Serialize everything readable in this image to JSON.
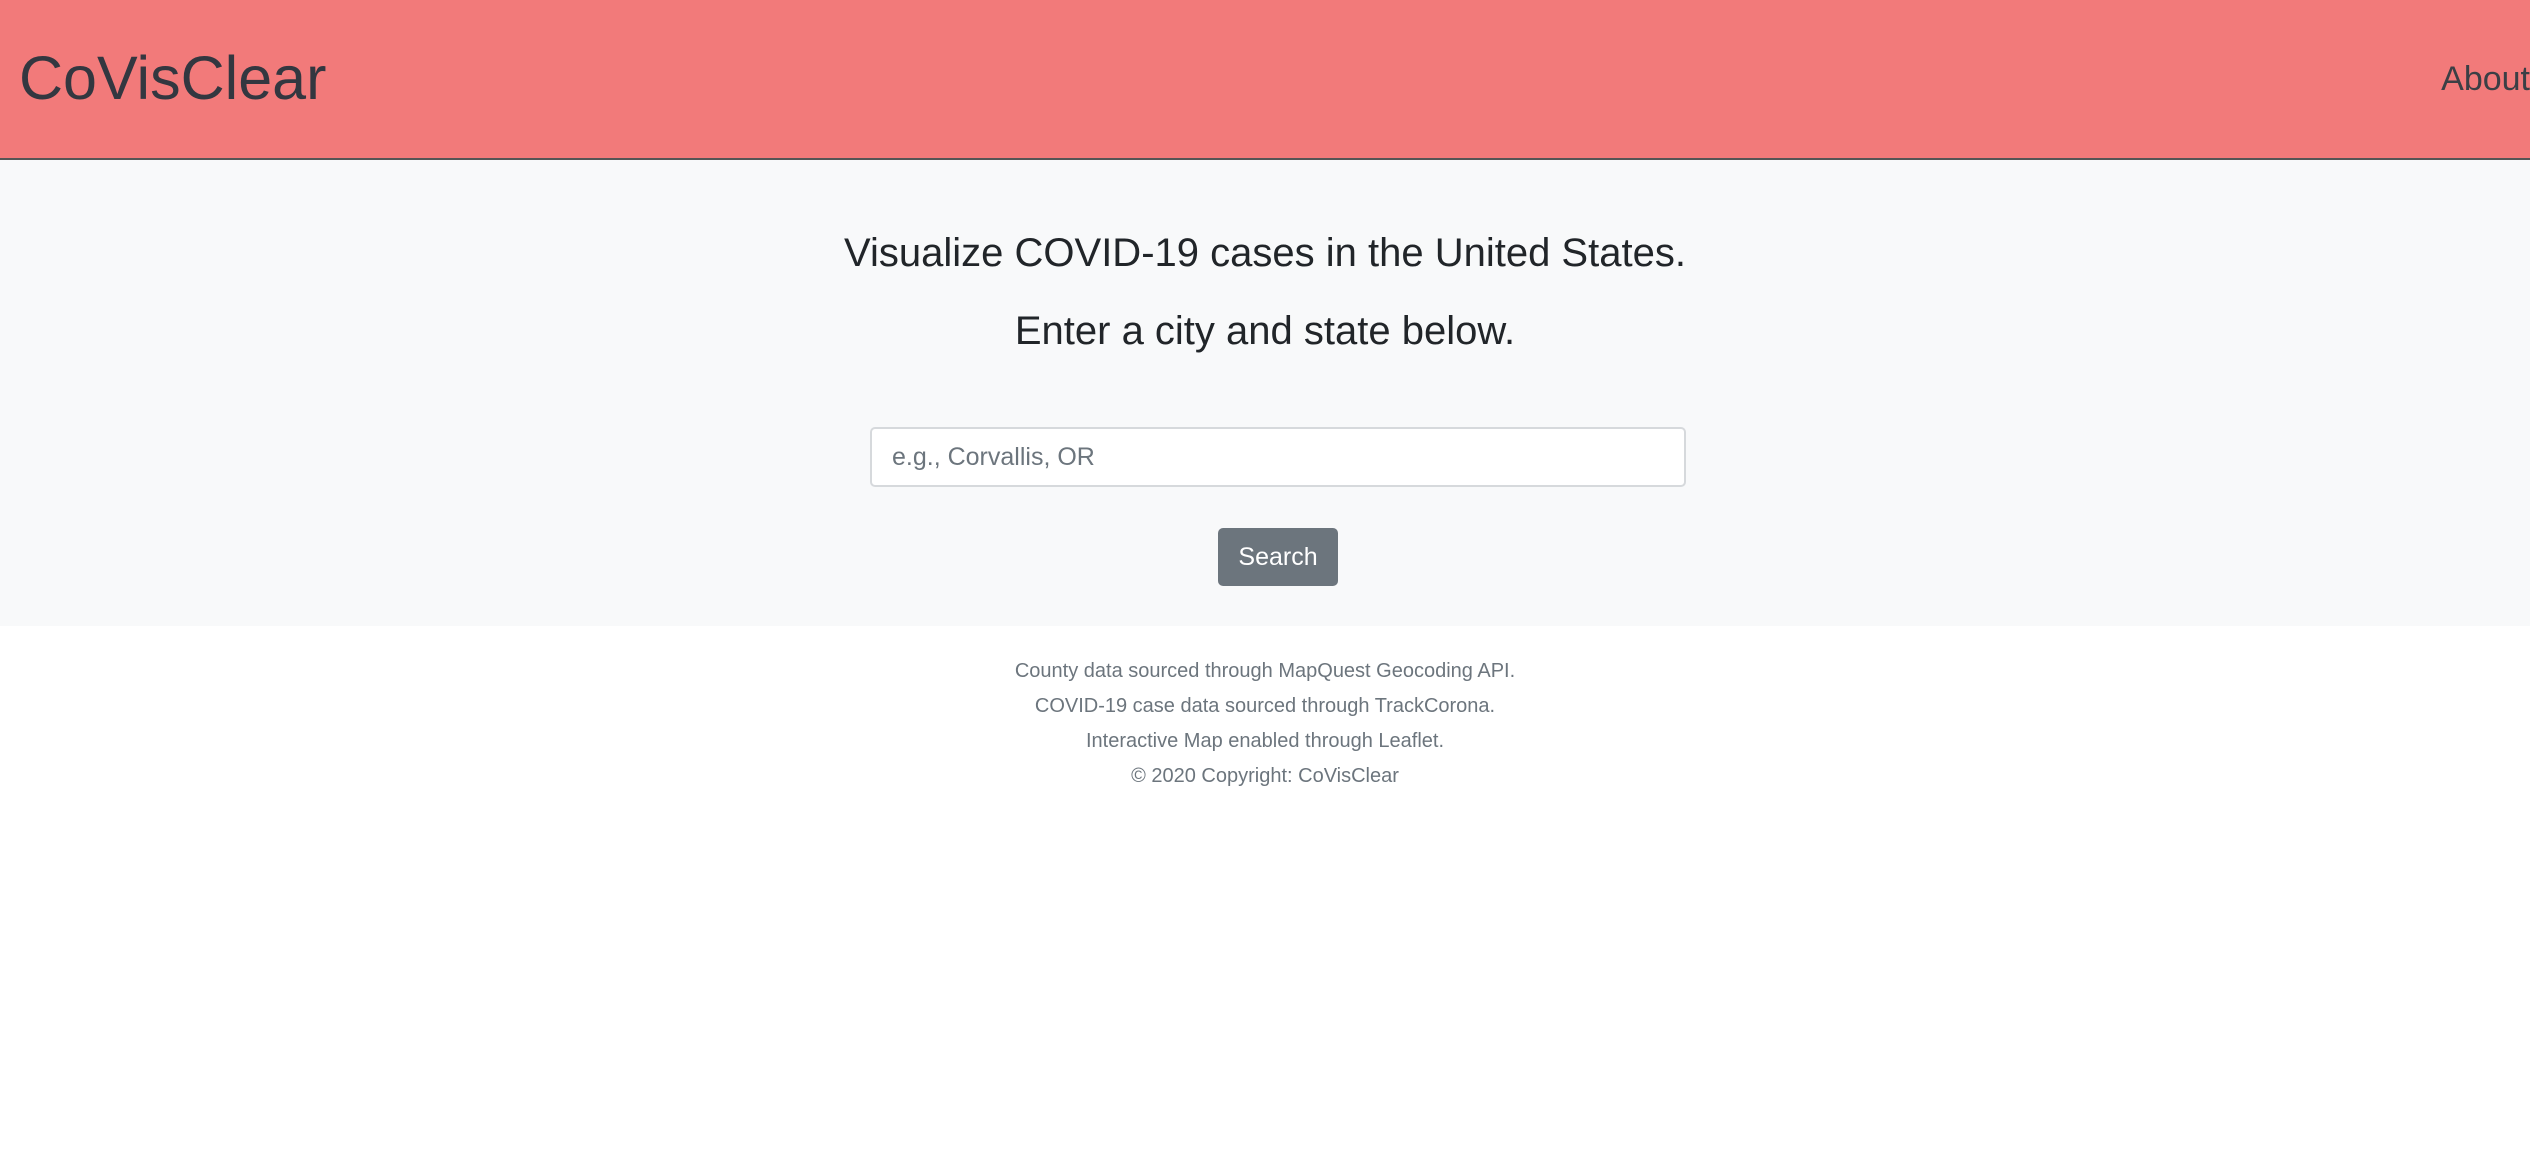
{
  "header": {
    "brand": "CoVisClear",
    "nav": {
      "about_label": "About"
    }
  },
  "hero": {
    "line1": "Visualize COVID-19 cases in the United States.",
    "line2": "Enter a city and state below.",
    "search": {
      "value": "",
      "placeholder": "e.g., Corvallis, OR"
    },
    "search_button_label": "Search"
  },
  "footer": {
    "lines": [
      "County data sourced through MapQuest Geocoding API.",
      "COVID-19 case data sourced through TrackCorona.",
      "Interactive Map enabled through Leaflet.",
      "© 2020 Copyright: CoVisClear"
    ]
  },
  "colors": {
    "header_background": "#f27a7a",
    "hero_background": "#f8f9fa",
    "button_background": "#6c757d",
    "text_dark": "#212529",
    "text_muted": "#6c757d"
  }
}
